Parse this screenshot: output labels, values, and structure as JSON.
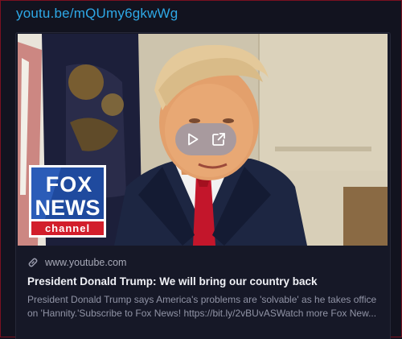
{
  "message": {
    "link_text": "youtu.be/mQUmy6gkwWg"
  },
  "embed": {
    "thumbnail": {
      "brand_line1": "FOX",
      "brand_line2": "NEWS",
      "brand_line3": "channel",
      "play_icon": "play-icon",
      "open_icon": "external-link-icon"
    },
    "domain_icon": "link-icon",
    "domain": "www.youtube.com",
    "title": "President Donald Trump: We will bring our country back",
    "description": "President Donald Trump says America's problems are 'solvable' as he takes office on 'Hannity.'Subscribe to Fox News! https://bit.ly/2vBUvASWatch more Fox New..."
  },
  "colors": {
    "background": "#12131f",
    "link": "#2ea8e6",
    "frame_border": "#7a1020",
    "fox_red": "#d21e2b",
    "fox_blue": "#1f4a9e"
  }
}
